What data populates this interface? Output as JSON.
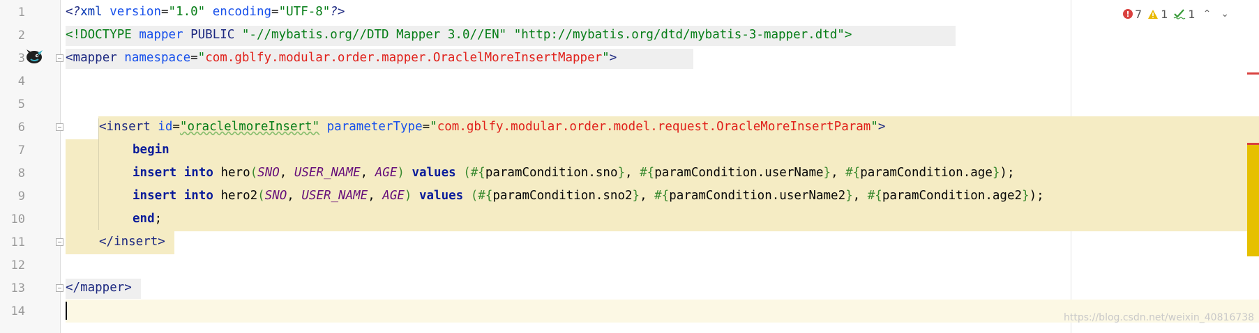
{
  "editor": {
    "line_numbers": [
      "1",
      "2",
      "3",
      "4",
      "5",
      "6",
      "7",
      "8",
      "9",
      "10",
      "11",
      "12",
      "13",
      "14"
    ],
    "lines": {
      "l1": {
        "a": "<?",
        "b": "xml",
        "c": " version",
        "d": "=",
        "e": "\"1.0\"",
        "f": " encoding",
        "g": "=",
        "h": "\"UTF-8\"",
        "i": "?>"
      },
      "l2": {
        "a": "<!DOCTYPE ",
        "b": "mapper",
        "c": " PUBLIC ",
        "d": "\"-//mybatis.org//DTD Mapper 3.0//EN\"",
        "e": " ",
        "f": "\"http://mybatis.org/dtd/mybatis-3-mapper.dtd\"",
        "g": ">"
      },
      "l3": {
        "a": "<",
        "b": "mapper",
        "c": " namespace",
        "d": "=",
        "e": "\"",
        "f": "com.gblfy.modular.order.mapper.OraclelMoreInsertMapper",
        "g": "\"",
        "h": ">"
      },
      "l6": {
        "a": "<",
        "b": "insert",
        "c": " id",
        "d": "=",
        "e": "\"oraclelmoreInsert\"",
        "f": " parameterType",
        "g": "=",
        "h": "\"",
        "i": "com.gblfy.modular.order.model.request.OracleMoreInsertParam",
        "j": "\"",
        "k": ">"
      },
      "l7": {
        "a": "begin"
      },
      "l8": {
        "a": "insert",
        "b": " ",
        "c": "into",
        "d": " hero",
        "e": "(",
        "f": "SNO",
        "g": ", ",
        "h": "USER_NAME",
        "i": ", ",
        "j": "AGE",
        "k": ")",
        "l": " ",
        "m": "values",
        "n": " (",
        "o": "#{",
        "p": "paramCondition.sno",
        "q": "}",
        "r": ", ",
        "s": "#{",
        "t": "paramCondition.userName",
        "u": "}",
        "v": ", ",
        "w": "#{",
        "x": "paramCondition.age",
        "y": "}",
        "z": ");"
      },
      "l9": {
        "a": "insert",
        "b": " ",
        "c": "into",
        "d": " hero2",
        "e": "(",
        "f": "SNO",
        "g": ", ",
        "h": "USER_NAME",
        "i": ", ",
        "j": "AGE",
        "k": ")",
        "l": " ",
        "m": "values",
        "n": " (",
        "o": "#{",
        "p": "paramCondition.sno2",
        "q": "}",
        "r": ", ",
        "s": "#{",
        "t": "paramCondition.userName2",
        "u": "}",
        "v": ", ",
        "w": "#{",
        "x": "paramCondition.age2",
        "y": "}",
        "z": ");"
      },
      "l10": {
        "a": "end",
        "b": ";"
      },
      "l11": {
        "a": "</",
        "b": "insert",
        "c": ">"
      },
      "l13": {
        "a": "</",
        "b": "mapper",
        "c": ">"
      }
    }
  },
  "inspections": {
    "errors": "7",
    "warnings": "1",
    "weak_warnings": "1",
    "error_icon": "error-icon",
    "warning_icon": "warning-icon",
    "typo_icon": "typo-check-icon",
    "up_icon": "chevron-up-icon",
    "down_icon": "chevron-down-icon"
  },
  "watermark": "https://blog.csdn.net/weixin_40816738",
  "colors": {
    "highlight": "#f5ecc4",
    "current_line": "#fcf8e4",
    "error_mark": "#d9413f",
    "warning_mark": "#e6c000"
  }
}
